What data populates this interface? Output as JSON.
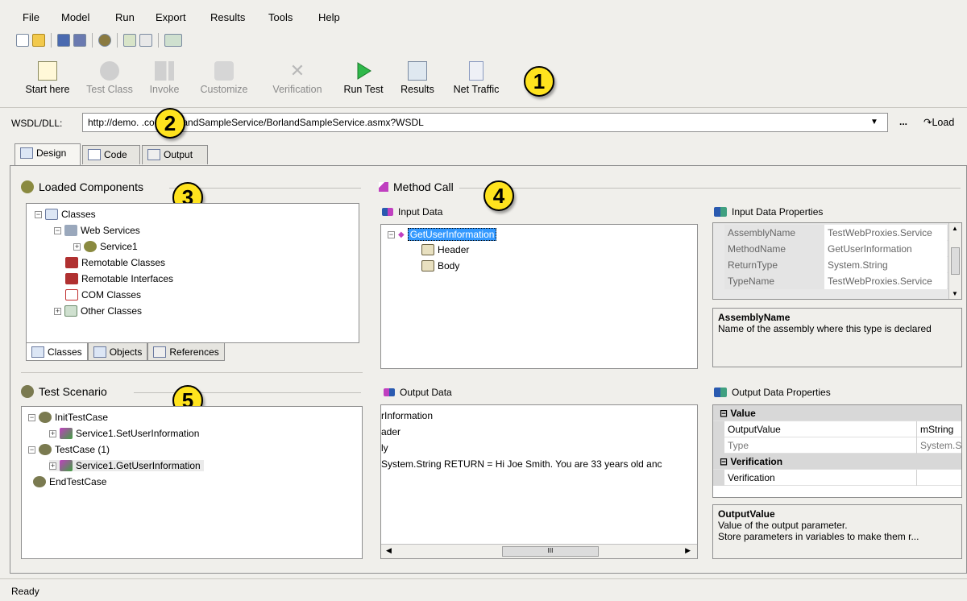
{
  "menu": [
    "File",
    "Model",
    "Run",
    "Export",
    "Results",
    "Tools",
    "Help"
  ],
  "toolbar": {
    "buttons": [
      {
        "label": "Start here",
        "icon": "start-here-icon",
        "enabled": true
      },
      {
        "label": "Test Class",
        "icon": "test-class-icon",
        "enabled": false
      },
      {
        "label": "Invoke",
        "icon": "invoke-icon",
        "enabled": false
      },
      {
        "label": "Customize",
        "icon": "customize-icon",
        "enabled": false
      },
      {
        "label": "Verification",
        "icon": "verification-icon",
        "enabled": false
      },
      {
        "label": "Run Test",
        "icon": "run-test-icon",
        "enabled": true
      },
      {
        "label": "Results",
        "icon": "results-icon",
        "enabled": true
      },
      {
        "label": "Net Traffic",
        "icon": "net-traffic-icon",
        "enabled": true
      }
    ]
  },
  "callouts": [
    "1",
    "2",
    "3",
    "4",
    "5"
  ],
  "wsdl": {
    "label": "WSDL/DLL:",
    "value": "http://demo.        .com/BorlandSampleService/BorlandSampleService.asmx?WSDL",
    "dots": "...",
    "load_label": "Load"
  },
  "tabs": [
    "Design",
    "Code",
    "Output"
  ],
  "loaded_components": {
    "title": "Loaded Components",
    "tree": [
      "Classes",
      "Web Services",
      "Service1",
      "Remotable Classes",
      "Remotable Interfaces",
      "COM Classes",
      "Other Classes"
    ],
    "subtabs": [
      "Classes",
      "Objects",
      "References"
    ]
  },
  "method_call": {
    "title": "Method Call",
    "input_data_label": "Input Data",
    "input_tree": [
      "GetUserInformation",
      "Header",
      "Body"
    ],
    "output_data_label": "Output Data",
    "output_lines": [
      "rInformation",
      "ader",
      "ly",
      "System.String RETURN = Hi Joe Smith. You are 33 years old anc"
    ],
    "hscroll_mid": "III"
  },
  "input_props": {
    "title": "Input Data Properties",
    "rows": [
      {
        "name": "AssemblyName",
        "value": "TestWebProxies.Service"
      },
      {
        "name": "MethodName",
        "value": "GetUserInformation"
      },
      {
        "name": "ReturnType",
        "value": "System.String"
      },
      {
        "name": "TypeName",
        "value": "TestWebProxies.Service"
      }
    ],
    "desc_title": "AssemblyName",
    "desc_text": "Name of the assembly where this type is declared"
  },
  "output_props": {
    "title": "Output Data Properties",
    "cat_value": "Value",
    "rows1": [
      {
        "name": "OutputValue",
        "value": "mString"
      },
      {
        "name": "Type",
        "value": "System.S"
      }
    ],
    "cat_verification": "Verification",
    "rows2": [
      {
        "name": "Verification",
        "value": ""
      }
    ],
    "desc_title": "OutputValue",
    "desc_line1": "Value of the output parameter.",
    "desc_line2": "Store parameters in variables to make them r..."
  },
  "test_scenario": {
    "title": "Test Scenario",
    "tree": [
      "InitTestCase",
      "Service1.SetUserInformation",
      "TestCase (1)",
      "Service1.GetUserInformation",
      "EndTestCase"
    ]
  },
  "status": "Ready",
  "colors": {
    "callout": "#ffe31e",
    "selection": "#3399ff"
  }
}
